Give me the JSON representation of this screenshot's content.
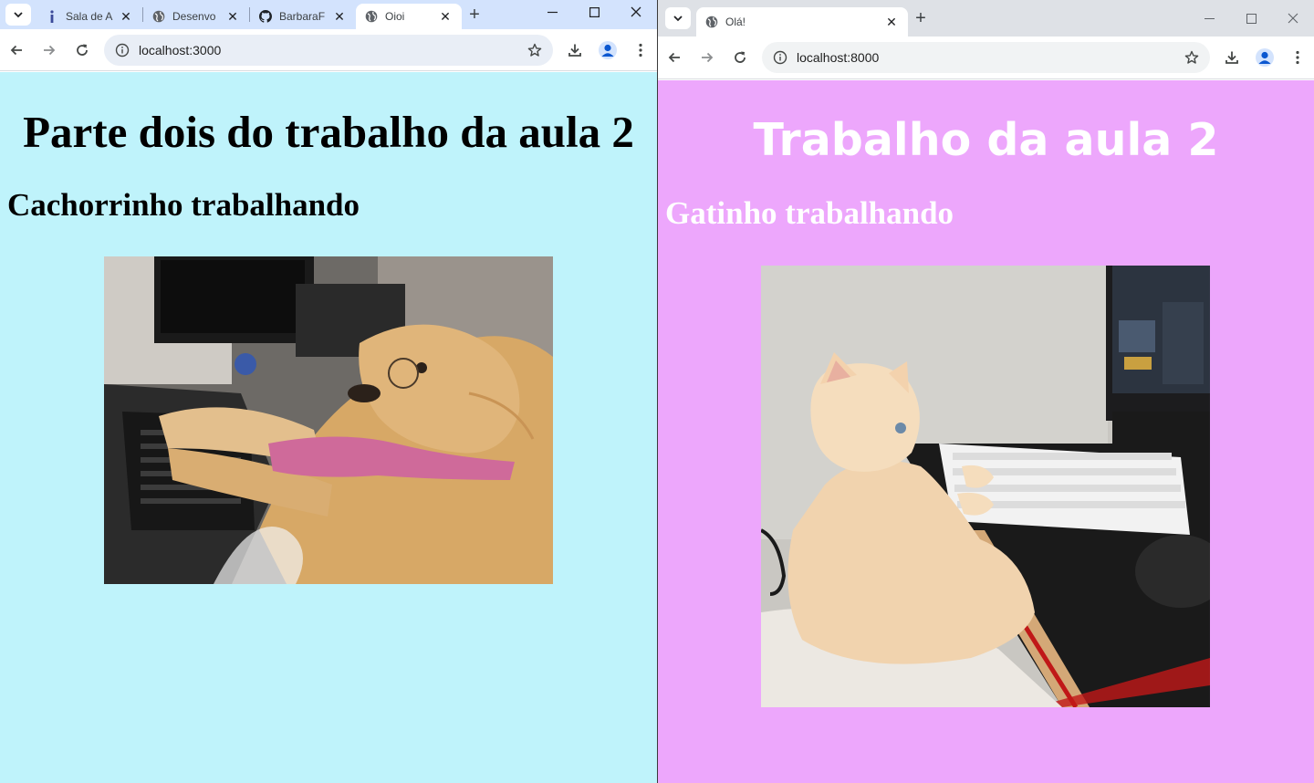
{
  "left_window": {
    "tabs": [
      {
        "icon": "info-icon",
        "title": "Sala de A"
      },
      {
        "icon": "globe-icon",
        "title": "Desenvo"
      },
      {
        "icon": "github-icon",
        "title": "BarbaraF"
      },
      {
        "icon": "globe-icon",
        "title": "Oioi",
        "active": true
      }
    ],
    "url": "localhost:3000",
    "page": {
      "background": "#bff3fb",
      "heading": "Parte dois do trabalho da aula 2",
      "subheading": "Cachorrinho trabalhando",
      "image_subject": "golden retriever dog with glasses and pink tie typing on laptop keyboard"
    }
  },
  "right_window": {
    "tabs": [
      {
        "icon": "globe-icon",
        "title": "Olá!",
        "active": true
      }
    ],
    "url": "localhost:8000",
    "page": {
      "background": "#eda7fc",
      "heading": "Trabalho da aula 2",
      "subheading": "Gatinho trabalhando",
      "image_subject": "cream colored cat sitting at a white mechanical keyboard with monitor and mouse"
    }
  }
}
